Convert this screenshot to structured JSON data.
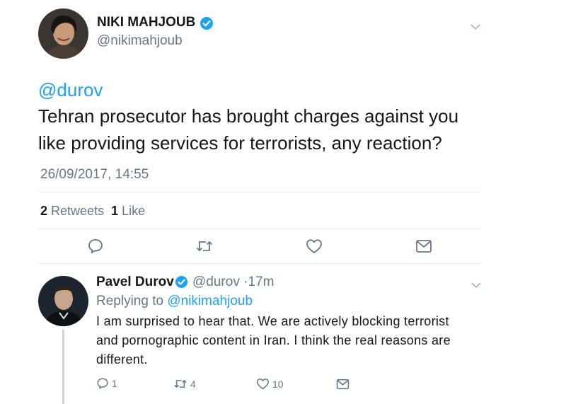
{
  "tweet": {
    "author_name": "NIKI MAHJOUB",
    "author_handle": "@nikimahjoub",
    "mention": "@durov",
    "text": "Tehran prosecutor has brought charges against you like providing services for terrorists, any reaction?",
    "timestamp": "26/09/2017, 14:55",
    "retweet_count": "2",
    "retweet_label": "Retweets",
    "like_count": "1",
    "like_label": "Like",
    "actions": [
      "reply-icon",
      "retweet-icon",
      "like-icon",
      "message-icon"
    ]
  },
  "reply": {
    "author_name": "Pavel Durov",
    "author_handle": "@durov",
    "separator": "·",
    "time_ago": "17m",
    "replying_prefix": "Replying to",
    "replying_to": "@nikimahjoub",
    "text": "I am surprised to hear that. We are actively blocking terrorist and pornographic content in Iran. I think the real reasons are different.",
    "reply_count": "1",
    "retweet_count": "4",
    "like_count": "10"
  },
  "colors": {
    "link": "#1da1f2",
    "muted": "#657786",
    "text": "#14171a",
    "divider": "#e6ecf0",
    "verified": "#1da1f2"
  }
}
